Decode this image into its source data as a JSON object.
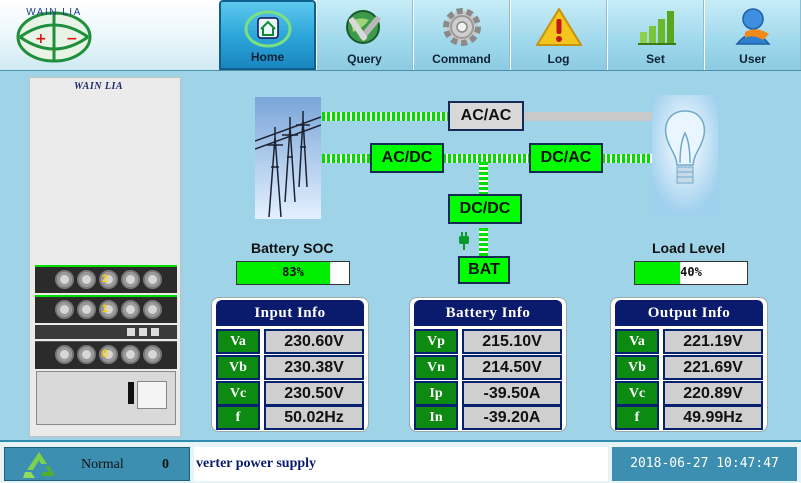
{
  "logo": {
    "text": "WAIN LIA"
  },
  "nav": {
    "tabs": [
      {
        "label": "Home",
        "icon": "home-icon",
        "active": true
      },
      {
        "label": "Query",
        "icon": "query-icon",
        "active": false
      },
      {
        "label": "Command",
        "icon": "gear-icon",
        "active": false
      },
      {
        "label": "Log",
        "icon": "warning-icon",
        "active": false
      },
      {
        "label": "Set",
        "icon": "bar-chart-icon",
        "active": false
      },
      {
        "label": "User",
        "icon": "user-icon",
        "active": false
      }
    ]
  },
  "cabinet": {
    "brand": "WAIN LIA",
    "modules": [
      "2",
      "1",
      "0"
    ]
  },
  "diagram": {
    "ac_ac": "AC/AC",
    "ac_dc": "AC/DC",
    "dc_ac": "DC/AC",
    "dc_dc": "DC/DC",
    "bat": "BAT"
  },
  "battery_soc": {
    "label": "Battery SOC",
    "value": 83,
    "text": "83%"
  },
  "load_level": {
    "label": "Load Level",
    "value": 40,
    "text": "40%"
  },
  "input_info": {
    "title": "Input Info",
    "rows": [
      {
        "key": "Va",
        "value": "230.60V"
      },
      {
        "key": "Vb",
        "value": "230.38V"
      },
      {
        "key": "Vc",
        "value": "230.50V"
      },
      {
        "key": "f",
        "value": "50.02Hz"
      }
    ]
  },
  "battery_info": {
    "title": "Battery Info",
    "rows": [
      {
        "key": "Vp",
        "value": "215.10V"
      },
      {
        "key": "Vn",
        "value": "214.50V"
      },
      {
        "key": "Ip",
        "value": "-39.50A"
      },
      {
        "key": "In",
        "value": "-39.20A"
      }
    ]
  },
  "output_info": {
    "title": "Output Info",
    "rows": [
      {
        "key": "Va",
        "value": "221.19V"
      },
      {
        "key": "Vb",
        "value": "221.69V"
      },
      {
        "key": "Vc",
        "value": "220.89V"
      },
      {
        "key": "f",
        "value": "49.99Hz"
      }
    ]
  },
  "status": {
    "mode": "Normal",
    "code": "0",
    "message": "verter power supply",
    "datetime": "2018-06-27 10:47:47"
  },
  "colors": {
    "background": "#9fd3e8",
    "flow_green": "#00ff00",
    "panel_title": "#0a1a6c",
    "key_cell": "#0d8a12",
    "active_tab": "#2aa3d8"
  }
}
